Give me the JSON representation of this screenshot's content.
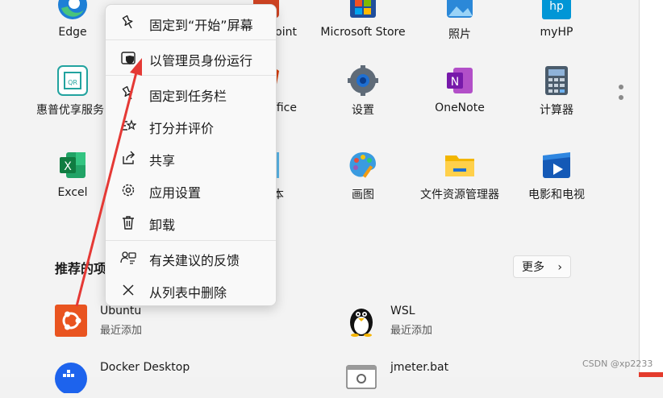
{
  "pinned_apps": [
    {
      "label": "Edge",
      "icon": "edge-icon"
    },
    {
      "label": "Microsoft Store",
      "icon": "store-icon"
    },
    {
      "label": "照片",
      "icon": "photos-icon"
    },
    {
      "label": "myHP",
      "icon": "myhp-icon"
    },
    {
      "label": "惠普优享服务",
      "icon": "hp-service-icon"
    },
    {
      "label": "设置",
      "icon": "settings-icon"
    },
    {
      "label": "OneNote",
      "icon": "onenote-icon"
    },
    {
      "label": "计算器",
      "icon": "calculator-icon"
    },
    {
      "label": "Excel",
      "icon": "excel-icon"
    },
    {
      "label": "画图",
      "icon": "paint-icon"
    },
    {
      "label": "文件资源管理器",
      "icon": "explorer-icon"
    },
    {
      "label": "电影和电视",
      "icon": "movies-icon"
    }
  ],
  "partial_labels": {
    "powerpoint": "oint",
    "office": "ffice",
    "notepad": "本"
  },
  "recommended": {
    "title": "推荐的项",
    "more_label": "更多",
    "items": [
      {
        "name": "Ubuntu",
        "sub": "最近添加",
        "icon": "ubuntu-icon"
      },
      {
        "name": "WSL",
        "sub": "最近添加",
        "icon": "wsl-penguin-icon"
      },
      {
        "name": "Docker Desktop",
        "sub": "",
        "icon": "docker-icon"
      },
      {
        "name": "jmeter.bat",
        "sub": "",
        "icon": "bat-file-icon"
      }
    ]
  },
  "context_menu": {
    "items": [
      {
        "label": "固定到“开始”屏幕",
        "icon": "pin-icon"
      },
      {
        "label": "以管理员身份运行",
        "icon": "shield-icon"
      },
      {
        "label": "固定到任务栏",
        "icon": "pin-icon"
      },
      {
        "label": "打分并评价",
        "icon": "rate-icon"
      },
      {
        "label": "共享",
        "icon": "share-icon"
      },
      {
        "label": "应用设置",
        "icon": "gear-icon"
      },
      {
        "label": "卸载",
        "icon": "trash-icon"
      },
      {
        "label": "有关建议的反馈",
        "icon": "feedback-icon"
      },
      {
        "label": "从列表中删除",
        "icon": "close-icon"
      }
    ]
  },
  "watermark": "CSDN @xp2233",
  "colors": {
    "annotation_arrow": "#e53935",
    "accent": "#0067c0"
  }
}
